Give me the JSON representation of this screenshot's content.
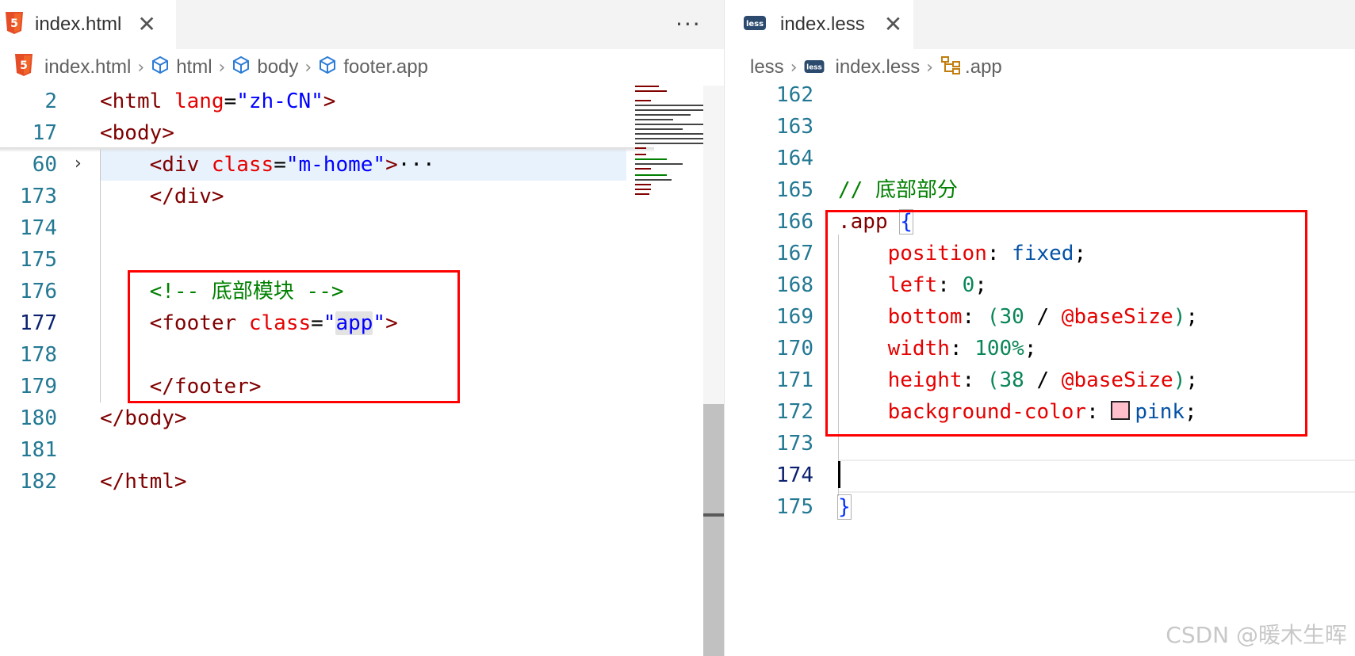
{
  "watermark": "CSDN @暖木生晖",
  "colors": {
    "accent_pink": "#ffc0cb",
    "highlight_box": "#ff0000",
    "line_number": "#237893"
  },
  "left": {
    "tab": {
      "label": "index.html",
      "icon": "html5-icon"
    },
    "more_label": "···",
    "breadcrumb": [
      "index.html",
      "html",
      "body",
      "footer.app"
    ],
    "lines": [
      {
        "num": "2",
        "tokens": [
          [
            "<",
            "t-tag"
          ],
          [
            "html",
            "t-tag"
          ],
          [
            " ",
            "t-txt"
          ],
          [
            "lang",
            "t-attr"
          ],
          [
            "=",
            "t-txt"
          ],
          [
            "\"zh-CN\"",
            "t-str"
          ],
          [
            ">",
            "t-tag"
          ]
        ]
      },
      {
        "num": "17",
        "tokens": [
          [
            "<body>",
            "t-tag"
          ]
        ]
      },
      {
        "num": "60",
        "tokens": [
          [
            "    ",
            "t-txt"
          ],
          [
            "<div",
            "t-tag"
          ],
          [
            " ",
            "t-txt"
          ],
          [
            "class",
            "t-attr"
          ],
          [
            "=",
            "t-txt"
          ],
          [
            "\"m-home\"",
            "t-str"
          ],
          [
            ">",
            "t-tag"
          ],
          [
            "···",
            "t-txt"
          ]
        ]
      },
      {
        "num": "173",
        "tokens": [
          [
            "    ",
            "t-txt"
          ],
          [
            "</div>",
            "t-tag"
          ]
        ]
      },
      {
        "num": "174",
        "tokens": []
      },
      {
        "num": "175",
        "tokens": []
      },
      {
        "num": "176",
        "tokens": [
          [
            "    ",
            "t-txt"
          ],
          [
            "<!-- 底部模块 -->",
            "t-com"
          ]
        ]
      },
      {
        "num": "177",
        "tokens": [
          [
            "    ",
            "t-txt"
          ],
          [
            "<footer",
            "t-tag"
          ],
          [
            " ",
            "t-txt"
          ],
          [
            "class",
            "t-attr"
          ],
          [
            "=",
            "t-txt"
          ],
          [
            "\"",
            "t-str"
          ],
          [
            "app",
            "t-str hlw"
          ],
          [
            "\"",
            "t-str"
          ],
          [
            ">",
            "t-tag"
          ]
        ]
      },
      {
        "num": "178",
        "tokens": []
      },
      {
        "num": "179",
        "tokens": [
          [
            "    ",
            "t-txt"
          ],
          [
            "</footer>",
            "t-tag"
          ]
        ]
      },
      {
        "num": "180",
        "tokens": [
          [
            "</body>",
            "t-tag"
          ]
        ]
      },
      {
        "num": "181",
        "tokens": []
      },
      {
        "num": "182",
        "tokens": [
          [
            "</html>",
            "t-tag"
          ]
        ]
      }
    ]
  },
  "right": {
    "tab": {
      "label": "index.less",
      "icon": "less-icon"
    },
    "breadcrumb": [
      "less",
      "index.less",
      ".app"
    ],
    "lines": [
      {
        "num": "162",
        "tokens": []
      },
      {
        "num": "163",
        "tokens": []
      },
      {
        "num": "164",
        "tokens": []
      },
      {
        "num": "165",
        "tokens": [
          [
            "// 底部部分",
            "t-com"
          ]
        ]
      },
      {
        "num": "166",
        "tokens": [
          [
            ".app",
            "t-sel"
          ],
          [
            " ",
            "t-txt"
          ],
          [
            "{",
            "t-brace bb"
          ]
        ]
      },
      {
        "num": "167",
        "tokens": [
          [
            "    ",
            "t-txt"
          ],
          [
            "position",
            "t-prop"
          ],
          [
            ": ",
            "t-txt"
          ],
          [
            "fixed",
            "t-val"
          ],
          [
            ";",
            "t-txt"
          ]
        ]
      },
      {
        "num": "168",
        "tokens": [
          [
            "    ",
            "t-txt"
          ],
          [
            "left",
            "t-prop"
          ],
          [
            ": ",
            "t-txt"
          ],
          [
            "0",
            "t-num"
          ],
          [
            ";",
            "t-txt"
          ]
        ]
      },
      {
        "num": "169",
        "tokens": [
          [
            "    ",
            "t-txt"
          ],
          [
            "bottom",
            "t-prop"
          ],
          [
            ": ",
            "t-txt"
          ],
          [
            "(",
            "t-num"
          ],
          [
            "30",
            "t-num"
          ],
          [
            " / ",
            "t-txt"
          ],
          [
            "@baseSize",
            "t-var"
          ],
          [
            ")",
            "t-num"
          ],
          [
            ";",
            "t-txt"
          ]
        ]
      },
      {
        "num": "170",
        "tokens": [
          [
            "    ",
            "t-txt"
          ],
          [
            "width",
            "t-prop"
          ],
          [
            ": ",
            "t-txt"
          ],
          [
            "100%",
            "t-num"
          ],
          [
            ";",
            "t-txt"
          ]
        ]
      },
      {
        "num": "171",
        "tokens": [
          [
            "    ",
            "t-txt"
          ],
          [
            "height",
            "t-prop"
          ],
          [
            ": ",
            "t-txt"
          ],
          [
            "(",
            "t-num"
          ],
          [
            "38",
            "t-num"
          ],
          [
            " / ",
            "t-txt"
          ],
          [
            "@baseSize",
            "t-var"
          ],
          [
            ")",
            "t-num"
          ],
          [
            ";",
            "t-txt"
          ]
        ]
      },
      {
        "num": "172",
        "tokens": [
          [
            "    ",
            "t-txt"
          ],
          [
            "background-color",
            "t-prop"
          ],
          [
            ": ",
            "t-txt"
          ],
          [
            "",
            "swatch"
          ],
          [
            "pink",
            "t-val"
          ],
          [
            ";",
            "t-txt"
          ]
        ]
      },
      {
        "num": "173",
        "tokens": []
      },
      {
        "num": "174",
        "tokens": []
      },
      {
        "num": "175",
        "tokens": [
          [
            "}",
            "t-brace bb"
          ]
        ]
      }
    ]
  }
}
